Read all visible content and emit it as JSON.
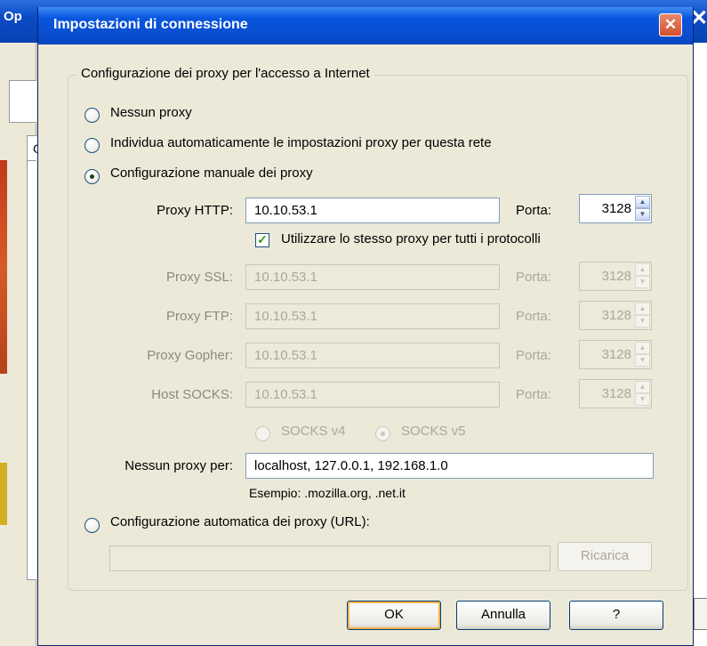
{
  "background": {
    "window_title_fragment": "Op",
    "tab_fragment": "G"
  },
  "dialog": {
    "title": "Impostazioni di connessione",
    "close_glyph": "✕"
  },
  "group": {
    "legend": "Configurazione dei proxy per l'accesso a Internet"
  },
  "options": {
    "no_proxy": "Nessun proxy",
    "auto_detect": "Individua automaticamente le impostazioni proxy per questa rete",
    "manual": "Configurazione manuale dei proxy",
    "auto_url": "Configurazione automatica dei proxy (URL):",
    "selected": "manual"
  },
  "manual": {
    "http": {
      "label": "Proxy HTTP:",
      "value": "10.10.53.1",
      "port_label": "Porta:",
      "port": "3128"
    },
    "same_proxy": {
      "label": "Utilizzare lo stesso proxy per tutti i protocolli",
      "checked": true
    },
    "ssl": {
      "label": "Proxy SSL:",
      "value": "10.10.53.1",
      "port_label": "Porta:",
      "port": "3128"
    },
    "ftp": {
      "label": "Proxy FTP:",
      "value": "10.10.53.1",
      "port_label": "Porta:",
      "port": "3128"
    },
    "gopher": {
      "label": "Proxy Gopher:",
      "value": "10.10.53.1",
      "port_label": "Porta:",
      "port": "3128"
    },
    "socks": {
      "label": "Host SOCKS:",
      "value": "10.10.53.1",
      "port_label": "Porta:",
      "port": "3128"
    },
    "socks_v4": "SOCKS v4",
    "socks_v5": "SOCKS v5",
    "no_proxy_for": {
      "label": "Nessun proxy per:",
      "value": "localhost, 127.0.0.1, 192.168.1.0"
    },
    "example": "Esempio: .mozilla.org, .net.it"
  },
  "auto_url": {
    "value": "",
    "reload_label": "Ricarica"
  },
  "buttons": {
    "ok": "OK",
    "cancel": "Annulla",
    "help": "?"
  }
}
